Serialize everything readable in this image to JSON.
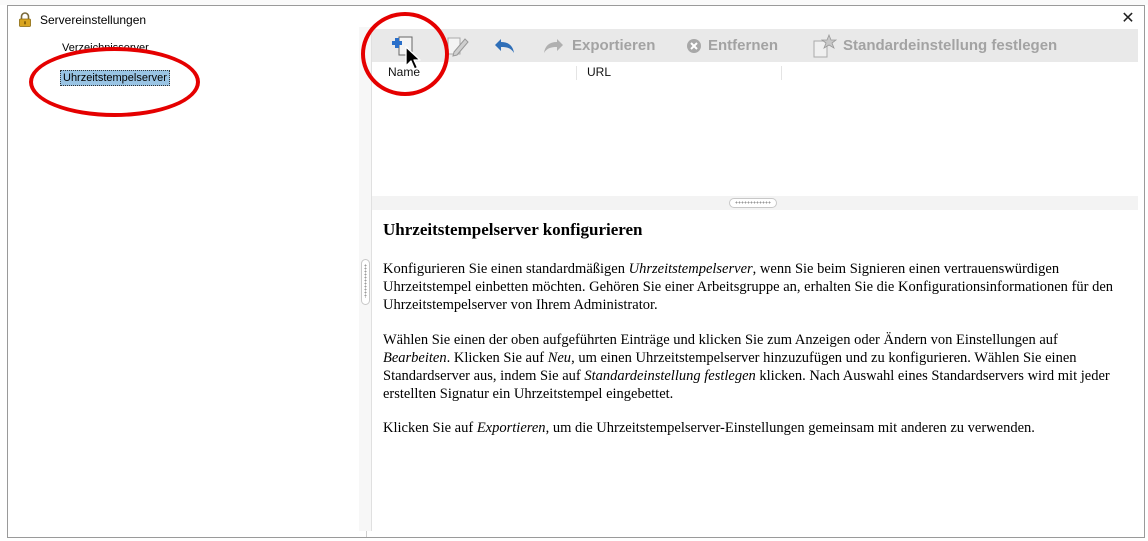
{
  "window": {
    "title": "Servereinstellungen",
    "icon": "lock-icon",
    "close_glyph": "✕"
  },
  "sidebar": {
    "items": [
      {
        "label": "Verzeichnisserver",
        "selected": false
      },
      {
        "label": "Uhrzeitstempelserver",
        "selected": true
      }
    ]
  },
  "toolbar": {
    "new_icon": "new-document-plus-icon",
    "edit_icon": "edit-pencil-icon",
    "import_icon": "undo-arrow-icon",
    "export_label": "Exportieren",
    "remove_label": "Entfernen",
    "default_label": "Standardeinstellung festlegen",
    "disabled_color": "#a3a3a3"
  },
  "list": {
    "columns": [
      "Name",
      "URL"
    ],
    "rows": []
  },
  "help": {
    "title": "Uhrzeitstempelserver konfigurieren",
    "p1": {
      "a": "Konfigurieren Sie einen standardmäßigen ",
      "em": "Uhrzeitstempelserver",
      "b": ", wenn Sie beim Signieren einen vertrauenswürdigen Uhrzeitstempel einbetten möchten. Gehören Sie einer Arbeitsgruppe an, erhalten Sie die Konfigurationsinformationen für den Uhrzeitstempelserver von Ihrem Administrator."
    },
    "p2": {
      "a": "Wählen Sie einen der oben aufgeführten Einträge und klicken Sie zum Anzeigen oder Ändern von Einstellungen auf ",
      "em1": "Bearbeiten",
      "b": ". Klicken Sie auf ",
      "em2": "Neu",
      "c": ", um einen Uhrzeitstempelserver hinzuzufügen und zu konfigurieren. Wählen Sie einen Standardserver aus, indem Sie auf ",
      "em3": "Standardeinstellung festlegen",
      "d": " klicken. Nach Auswahl eines Standardservers wird mit jeder erstellten Signatur ein Uhrzeitstempel eingebettet."
    },
    "p3": {
      "a": "Klicken Sie auf ",
      "em": "Exportieren",
      "b": ", um die Uhrzeitstempelserver-Einstellungen gemeinsam mit anderen zu verwenden."
    }
  },
  "annotations": {
    "highlight_color": "#e50000"
  }
}
